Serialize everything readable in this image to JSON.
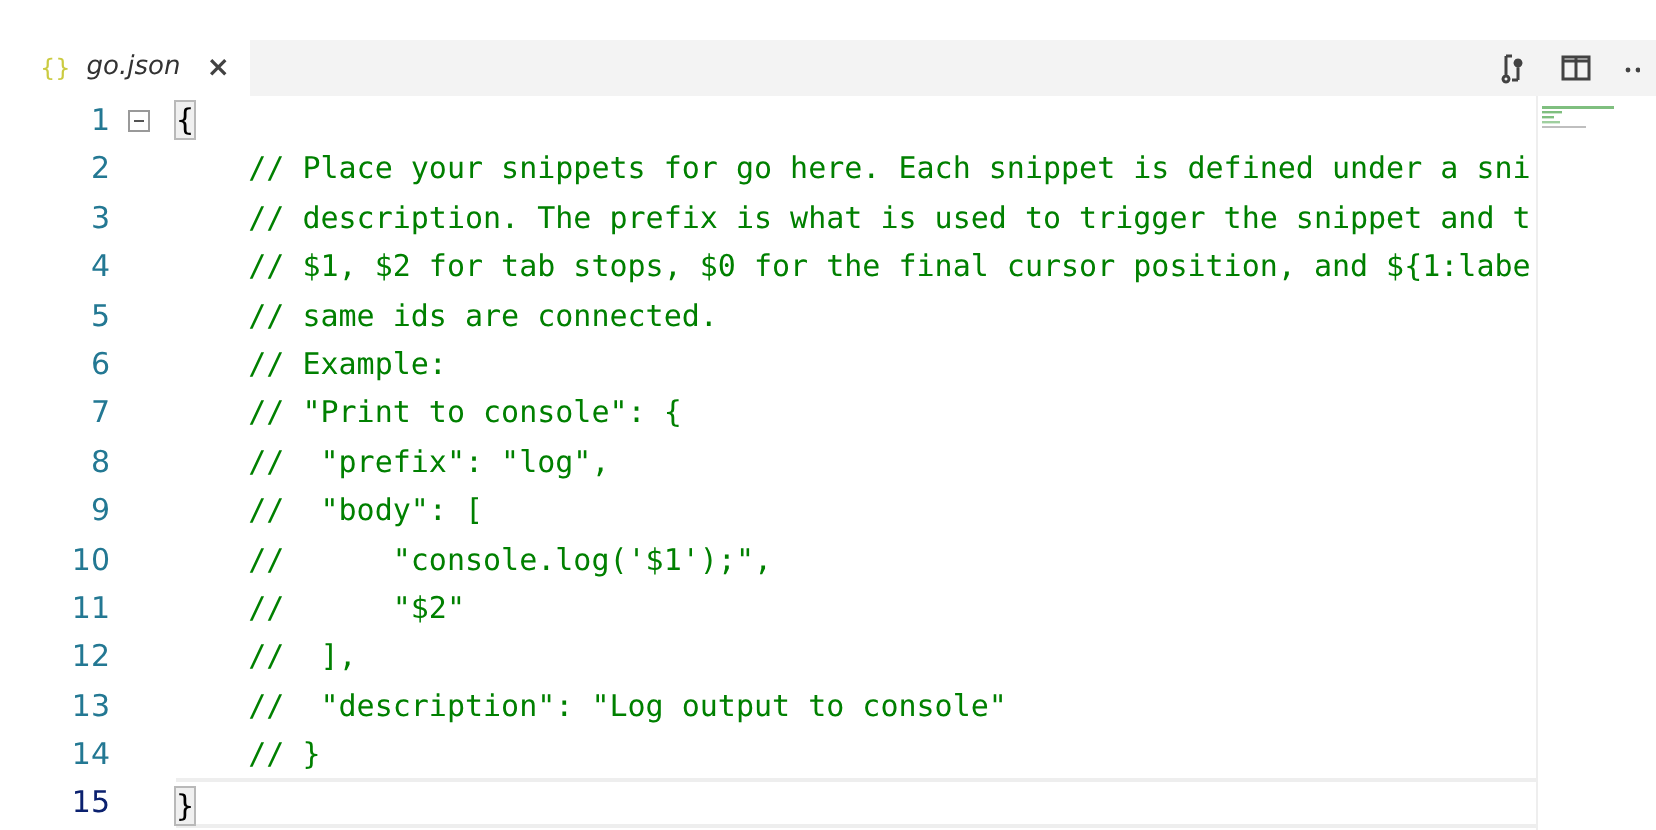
{
  "tab": {
    "icon": "{}",
    "label": "go.json",
    "italic": true,
    "close": "×"
  },
  "lines": [
    {
      "number": "1",
      "text": "{",
      "kind": "bracket",
      "current": false,
      "foldable": true
    },
    {
      "number": "2",
      "text": "    // Place your snippets for go here. Each snippet is defined under a sni",
      "kind": "comment",
      "current": false,
      "foldable": false
    },
    {
      "number": "3",
      "text": "    // description. The prefix is what is used to trigger the snippet and t",
      "kind": "comment",
      "current": false,
      "foldable": false
    },
    {
      "number": "4",
      "text": "    // $1, $2 for tab stops, $0 for the final cursor position, and ${1:labe",
      "kind": "comment",
      "current": false,
      "foldable": false
    },
    {
      "number": "5",
      "text": "    // same ids are connected.",
      "kind": "comment",
      "current": false,
      "foldable": false
    },
    {
      "number": "6",
      "text": "    // Example:",
      "kind": "comment",
      "current": false,
      "foldable": false
    },
    {
      "number": "7",
      "text": "    // \"Print to console\": {",
      "kind": "comment",
      "current": false,
      "foldable": false
    },
    {
      "number": "8",
      "text": "    //  \"prefix\": \"log\",",
      "kind": "comment",
      "current": false,
      "foldable": false
    },
    {
      "number": "9",
      "text": "    //  \"body\": [",
      "kind": "comment",
      "current": false,
      "foldable": false
    },
    {
      "number": "10",
      "text": "    //      \"console.log('$1');\",",
      "kind": "comment",
      "current": false,
      "foldable": false
    },
    {
      "number": "11",
      "text": "    //      \"$2\"",
      "kind": "comment",
      "current": false,
      "foldable": false
    },
    {
      "number": "12",
      "text": "    //  ],",
      "kind": "comment",
      "current": false,
      "foldable": false
    },
    {
      "number": "13",
      "text": "    //  \"description\": \"Log output to console\"",
      "kind": "comment",
      "current": false,
      "foldable": false
    },
    {
      "number": "14",
      "text": "    // }",
      "kind": "comment",
      "current": false,
      "foldable": false
    },
    {
      "number": "15",
      "text": "}",
      "kind": "bracket",
      "current": true,
      "foldable": false
    }
  ]
}
